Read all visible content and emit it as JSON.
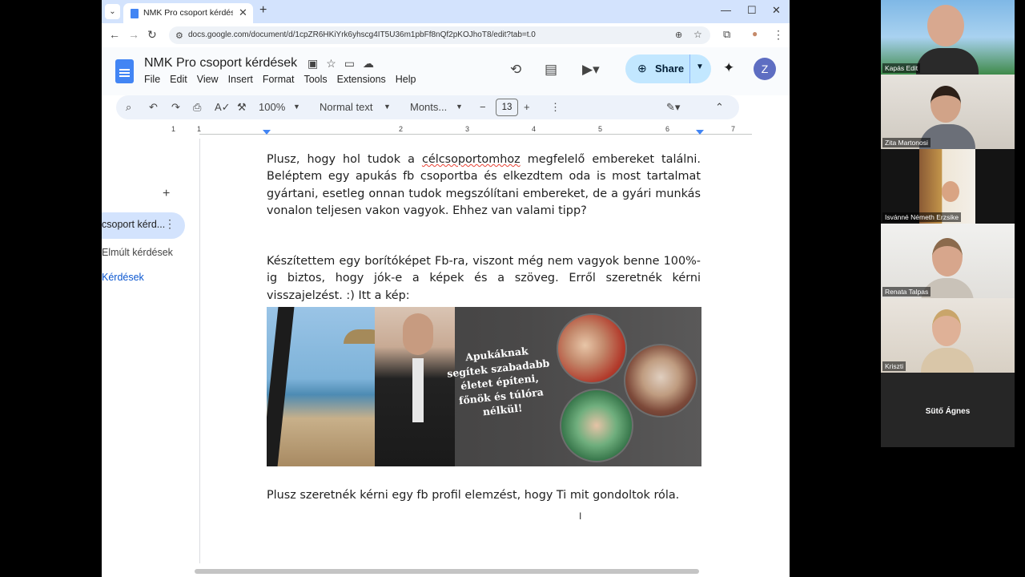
{
  "browser": {
    "tab_title": "NMK Pro csoport kérdések - Go",
    "new_tab_symbol": "+",
    "url": "docs.google.com/document/d/1cpZR6HKiYrk6yhscg4IT5U36m1pbFf8nQf2pKOJhoT8/edit?tab=t.0"
  },
  "docs": {
    "title": "NMK Pro csoport kérdések",
    "menu": [
      "File",
      "Edit",
      "View",
      "Insert",
      "Format",
      "Tools",
      "Extensions",
      "Help"
    ],
    "share_label": "Share",
    "avatar_letter": "Z",
    "toolbar": {
      "zoom": "100%",
      "style": "Normal text",
      "font": "Monts...",
      "font_size": "13"
    },
    "ruler_numbers": [
      "1",
      "1",
      "2",
      "3",
      "4",
      "5",
      "6",
      "7"
    ]
  },
  "outline": {
    "item1": "csoport kérd...",
    "item2": "Elmúlt kérdések",
    "item3": "Kérdések"
  },
  "document": {
    "para1_a": "Plusz, hogy hol tudok a ",
    "para1_misspelled": "célcsoportomhoz",
    "para1_b": " megfelelő embereket találni. Beléptem egy apukás fb csoportba és elkezdtem oda is most tartalmat gyártani, esetleg onnan tudok megszólítani embereket, de a gyári munkás vonalon teljesen vakon vagyok. Ehhez van valami tipp?",
    "para2": "Készítettem egy borítóképet Fb-ra, viszont még nem vagyok benne 100%-ig biztos, hogy jók-e a képek és a szöveg. Erről szeretnék kérni visszajelzést. :) Itt a kép:",
    "image_caption": [
      "Apukáknak",
      "segítek szabadabb",
      "életet építeni,",
      "főnök és túlóra",
      "nélkül!"
    ],
    "para3": "Plusz szeretnék kérni egy fb profil elemzést, hogy Ti mit gondoltok róla."
  },
  "participants": [
    {
      "name": "Kapás Edit"
    },
    {
      "name": "Zita Martonosi"
    },
    {
      "name": "Isvánné Németh Erzsike"
    },
    {
      "name": "Renata Talpas"
    },
    {
      "name": "Kriszti"
    },
    {
      "name": "Sütő Ágnes"
    }
  ]
}
